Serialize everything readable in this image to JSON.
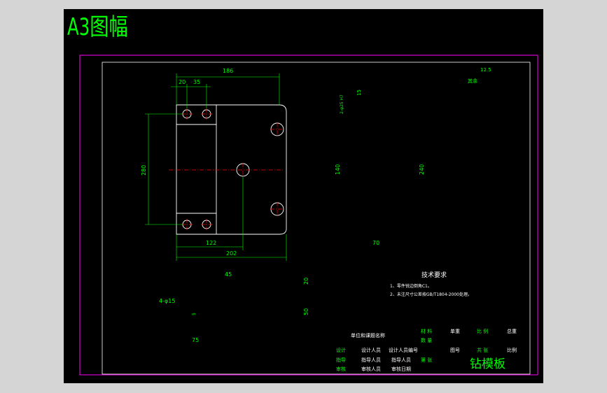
{
  "sheet_title": "A3图幅",
  "colors": {
    "frame": "#ff00ff",
    "outline": "#ffffff",
    "dimension": "#00ff00",
    "center": "#ff0000",
    "hatch": "#00ff00",
    "background": "#000000"
  },
  "top_view": {
    "dims": {
      "overall_width": "186",
      "hole_x1": "20",
      "hole_x2": "35",
      "height": "280",
      "inner_width": "122",
      "bottom_width": "202"
    }
  },
  "side_view": {
    "dims": {
      "fit": "2-φ25 H7",
      "depth": "15",
      "slot": "140",
      "height": "240",
      "width": "70"
    }
  },
  "roughness": {
    "value": "12.5",
    "label": "其余"
  },
  "bottom_view": {
    "dims": {
      "top": "45",
      "hole": "4-φ15",
      "hole_depth": "5",
      "right_top": "20",
      "right_bottom": "50",
      "left_width": "75"
    }
  },
  "tech_req": {
    "title": "技术要求",
    "items": [
      "1、零件锐边倒角C1。",
      "2、未注尺寸公差按GB/T1804-2000处理。"
    ]
  },
  "title_block": {
    "unit_name": "单位和课题名称",
    "material_label": "材  料",
    "scale_label": "比  例",
    "qty_label": "数  量",
    "drawing_no_label": "图号",
    "weight_label": "共  张",
    "sheet_label": "比例",
    "sheet_no_label": "第  张",
    "single": "单重",
    "total": "总重",
    "rows": [
      {
        "role": "设计",
        "name": "设计人员",
        "extra": "设计人员编号"
      },
      {
        "role": "指导",
        "name": "指导人员",
        "extra": "指导人员"
      },
      {
        "role": "审核",
        "name": "审核人员",
        "extra": "审核日期"
      }
    ],
    "cells_small": [
      "材料",
      "比例",
      "图号",
      "共",
      "第"
    ],
    "part_name": "钻模板"
  }
}
